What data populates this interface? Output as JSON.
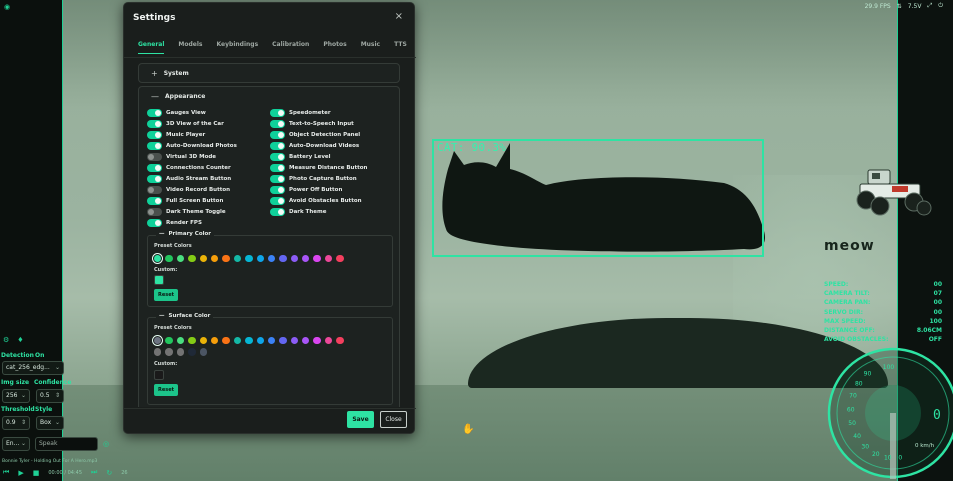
{
  "status_bar": {
    "fps": "29.9 FPS",
    "battery": "7.5V",
    "signal_icon": "wifi-icon"
  },
  "detection": {
    "label": "CAT: 90.3%"
  },
  "left_panel": {
    "detection_label": "Detection",
    "detection_value": "On",
    "model_select": "cat_256_edg...",
    "img_size_label": "Img size",
    "confidence_label": "Confidence",
    "img_size_value": "256",
    "confidence_value": "0.5",
    "threshold_label": "Threshold",
    "style_label": "Style",
    "threshold_value": "0.9",
    "style_value": "Box",
    "lang_value": "En...",
    "speak_placeholder": "Speak"
  },
  "player": {
    "song": "Bonnie Tyler - Holding Out For A Hero.mp3",
    "time": "00:00 / 04:45",
    "volume": "26"
  },
  "hud": {
    "meow": "meow",
    "stats": [
      {
        "label": "SPEED:",
        "value": "00"
      },
      {
        "label": "CAMERA TILT:",
        "value": "07"
      },
      {
        "label": "CAMERA PAN:",
        "value": "00"
      },
      {
        "label": "SERVO DIR:",
        "value": "00"
      },
      {
        "label": "MAX SPEED:",
        "value": "100"
      },
      {
        "label": "DISTANCE OFF:",
        "value": "8.06CM"
      },
      {
        "label": "AVOID OBSTACLES:",
        "value": "OFF"
      }
    ],
    "gauge_ticks": [
      "100",
      "90",
      "80",
      "70",
      "60",
      "50",
      "40",
      "30",
      "20",
      "10",
      "0"
    ],
    "gauge_speed": "0",
    "gauge_unit": "0 km/h"
  },
  "modal": {
    "title": "Settings",
    "tabs": [
      "General",
      "Models",
      "Keybindings",
      "Calibration",
      "Photos",
      "Music",
      "TTS"
    ],
    "active_tab": "General",
    "system_section": "System",
    "appearance_section": "Appearance",
    "toggles_left": [
      {
        "label": "Gauges View",
        "on": true
      },
      {
        "label": "3D View of the Car",
        "on": true
      },
      {
        "label": "Music Player",
        "on": true
      },
      {
        "label": "Auto-Download Photos",
        "on": true
      },
      {
        "label": "Virtual 3D Mode",
        "on": false
      },
      {
        "label": "Connections Counter",
        "on": true
      },
      {
        "label": "Audio Stream Button",
        "on": true
      },
      {
        "label": "Video Record Button",
        "on": false
      },
      {
        "label": "Full Screen Button",
        "on": true
      },
      {
        "label": "Dark Theme Toggle",
        "on": false
      },
      {
        "label": "Render FPS",
        "on": true
      }
    ],
    "toggles_right": [
      {
        "label": "Speedometer",
        "on": true
      },
      {
        "label": "Text-to-Speech Input",
        "on": true
      },
      {
        "label": "Object Detection Panel",
        "on": true
      },
      {
        "label": "Auto-Download Videos",
        "on": true
      },
      {
        "label": "Battery Level",
        "on": true
      },
      {
        "label": "Measure Distance Button",
        "on": true
      },
      {
        "label": "Photo Capture Button",
        "on": true
      },
      {
        "label": "Power Off Button",
        "on": true
      },
      {
        "label": "Avoid Obstacles Button",
        "on": true
      },
      {
        "label": "Dark Theme",
        "on": true
      }
    ],
    "primary_color": {
      "title": "Primary Color",
      "preset_label": "Preset Colors",
      "custom_label": "Custom:",
      "reset_label": "Reset",
      "custom_value": "#2ee3a3",
      "presets": [
        "#2ee3a3",
        "#22c55e",
        "#4ade80",
        "#84cc16",
        "#eab308",
        "#f59e0b",
        "#f97316",
        "#14b8a6",
        "#06b6d4",
        "#0ea5e9",
        "#3b82f6",
        "#6366f1",
        "#8b5cf6",
        "#a855f7",
        "#d946ef",
        "#ec4899",
        "#f43f5e"
      ]
    },
    "surface_color": {
      "title": "Surface Color",
      "preset_label": "Preset Colors",
      "custom_label": "Custom:",
      "reset_label": "Reset",
      "custom_value": "#1a1a1a",
      "presets": [
        "#6b7280",
        "#22c55e",
        "#4ade80",
        "#84cc16",
        "#eab308",
        "#f59e0b",
        "#f97316",
        "#14b8a6",
        "#06b6d4",
        "#0ea5e9",
        "#3b82f6",
        "#6366f1",
        "#8b5cf6",
        "#a855f7",
        "#d946ef",
        "#ec4899",
        "#f43f5e",
        "#737373",
        "#737373",
        "#737373",
        "#1f2937",
        "#4b5563"
      ]
    },
    "save_label": "Save",
    "close_label": "Close",
    "close_icon": "×"
  }
}
